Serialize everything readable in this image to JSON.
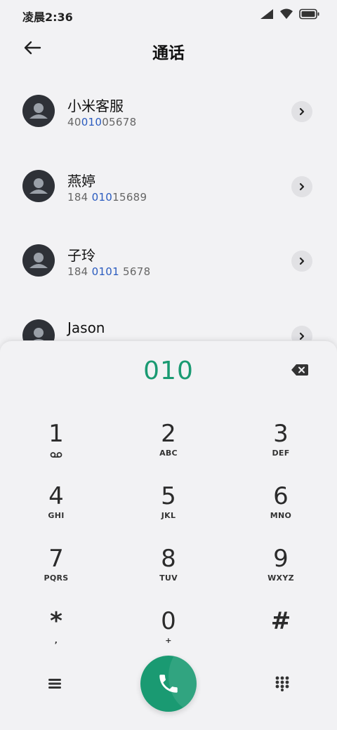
{
  "status_bar": {
    "time": "凌晨2:36",
    "icons": [
      "signal-icon",
      "wifi-icon",
      "battery-icon"
    ]
  },
  "header": {
    "title": "通话",
    "back_icon": "back-arrow-icon"
  },
  "contacts": [
    {
      "name": "小米客服",
      "number_pre": "40",
      "number_hl": "010",
      "number_post": "05678"
    },
    {
      "name": "燕婷",
      "number_pre": "184 ",
      "number_hl": "010",
      "number_post": "15689"
    },
    {
      "name": "子玲",
      "number_pre": "184 ",
      "number_hl": "0101",
      "number_post": " 5678"
    },
    {
      "name": "Jason",
      "number_pre": "",
      "number_hl": "",
      "number_post": ""
    }
  ],
  "dialer": {
    "input": "010",
    "keys": [
      {
        "digit": "1",
        "letters": ""
      },
      {
        "digit": "2",
        "letters": "ABC"
      },
      {
        "digit": "3",
        "letters": "DEF"
      },
      {
        "digit": "4",
        "letters": "GHI"
      },
      {
        "digit": "5",
        "letters": "JKL"
      },
      {
        "digit": "6",
        "letters": "MNO"
      },
      {
        "digit": "7",
        "letters": "PQRS"
      },
      {
        "digit": "8",
        "letters": "TUV"
      },
      {
        "digit": "9",
        "letters": "WXYZ"
      },
      {
        "digit": "*",
        "letters": ","
      },
      {
        "digit": "0",
        "letters": "+"
      },
      {
        "digit": "#",
        "letters": ""
      }
    ]
  },
  "colors": {
    "accent": "#1a9a72",
    "highlight": "#2a5bbf",
    "background": "#f2f2f4"
  }
}
